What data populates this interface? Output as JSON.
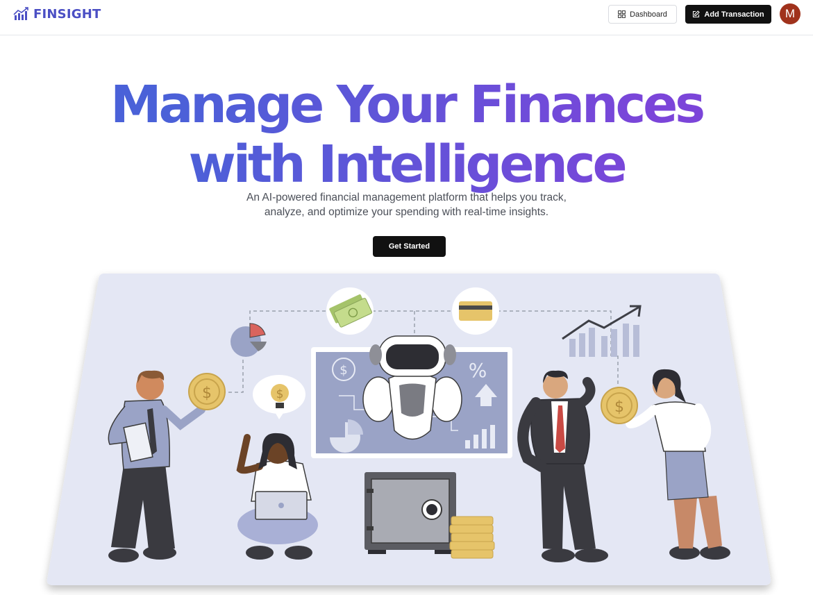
{
  "navbar": {
    "brand": "FINSIGHT",
    "brand_icon": "chart-logo-icon",
    "dashboard_label": "Dashboard",
    "dashboard_icon": "grid-icon",
    "add_transaction_label": "Add Transaction",
    "add_transaction_icon": "edit-icon",
    "avatar_initial": "M",
    "avatar_color": "#a0321c"
  },
  "hero": {
    "title_line1": "Manage Your Finances",
    "title_line2": "with Intelligence",
    "subtitle_line1": "An AI-powered financial management platform that helps you track,",
    "subtitle_line2": "analyze, and optimize your spending with real-time insights.",
    "cta_label": "Get Started",
    "gradient_start": "#4a61d8",
    "gradient_end": "#7b45d9"
  }
}
